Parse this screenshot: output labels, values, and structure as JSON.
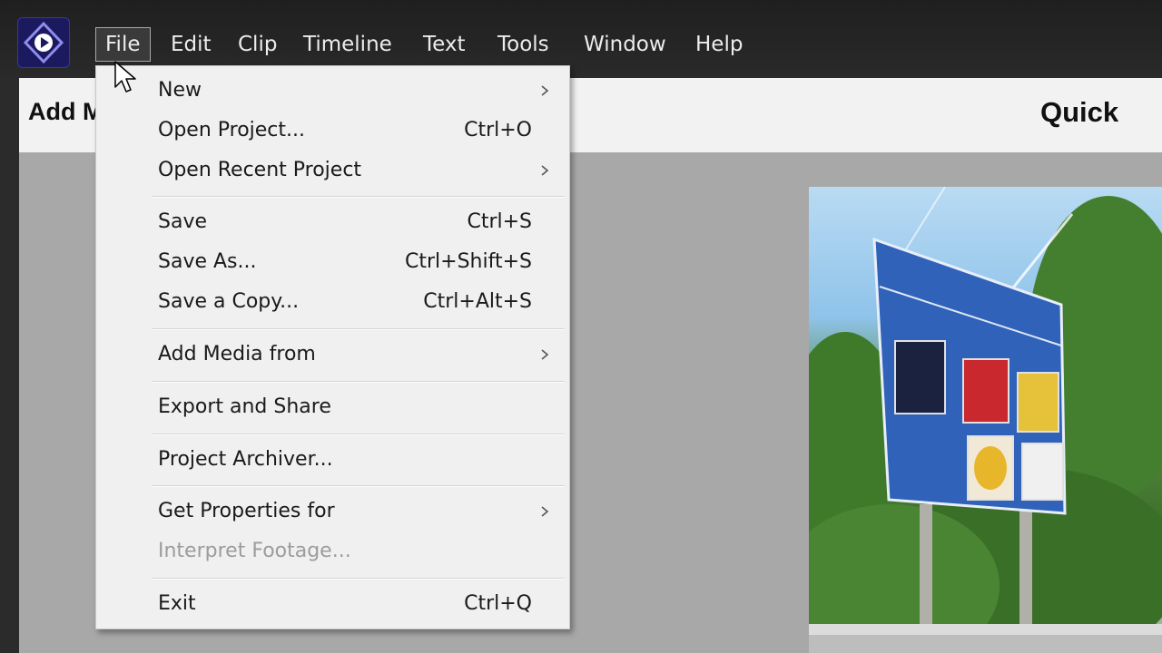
{
  "menubar": {
    "items": [
      {
        "label": "File",
        "active": true
      },
      {
        "label": "Edit"
      },
      {
        "label": "Clip"
      },
      {
        "label": "Timeline"
      },
      {
        "label": "Text"
      },
      {
        "label": "Tools"
      },
      {
        "label": "Window"
      },
      {
        "label": "Help"
      }
    ]
  },
  "workspace": {
    "title": "Add M",
    "mode_label": "Quick"
  },
  "file_menu": {
    "items": [
      {
        "label": "New",
        "submenu": true
      },
      {
        "label": "Open Project...",
        "shortcut": "Ctrl+O"
      },
      {
        "label": "Open Recent Project",
        "submenu": true
      },
      {
        "label": "Save",
        "shortcut": "Ctrl+S"
      },
      {
        "label": "Save As...",
        "shortcut": "Ctrl+Shift+S"
      },
      {
        "label": "Save a Copy...",
        "shortcut": "Ctrl+Alt+S"
      },
      {
        "label": "Add Media from",
        "submenu": true
      },
      {
        "label": "Export and Share"
      },
      {
        "label": "Project Archiver..."
      },
      {
        "label": "Get Properties for",
        "submenu": true
      },
      {
        "label": "Interpret Footage...",
        "disabled": true
      },
      {
        "label": "Exit",
        "shortcut": "Ctrl+Q"
      }
    ]
  },
  "colors": {
    "menubar_bg": "#262626",
    "menu_text": "#ececec",
    "dropdown_bg": "#f0f0f0",
    "workspace_bg": "#a8a8a8",
    "logo_bg": "#1c1a5e",
    "disabled_text": "#9c9c9c"
  },
  "icons": {
    "app_logo": "premiere-elements-logo-icon",
    "submenu": "chevron-right-icon",
    "pointer": "mouse-cursor-icon"
  }
}
